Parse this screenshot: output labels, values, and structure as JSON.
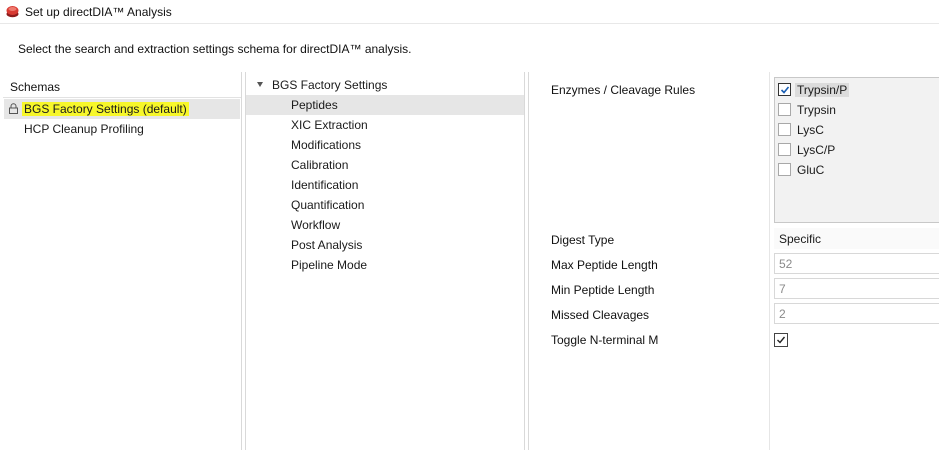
{
  "window": {
    "title": "Set up directDIA™ Analysis"
  },
  "instruction": "Select the search and extraction settings schema for directDIA™ analysis.",
  "schemas": {
    "header": "Schemas",
    "items": [
      {
        "label": "BGS Factory Settings (default)",
        "selected": true,
        "highlighted": true,
        "locked": true
      },
      {
        "label": "HCP Cleanup Profiling",
        "selected": false
      }
    ]
  },
  "tree": {
    "root": "BGS Factory Settings",
    "items": [
      {
        "label": "Peptides",
        "selected": true
      },
      {
        "label": "XIC Extraction"
      },
      {
        "label": "Modifications"
      },
      {
        "label": "Calibration"
      },
      {
        "label": "Identification"
      },
      {
        "label": "Quantification"
      },
      {
        "label": "Workflow"
      },
      {
        "label": "Post Analysis"
      },
      {
        "label": "Pipeline Mode"
      }
    ]
  },
  "settings": {
    "enzymes_label": "Enzymes / Cleavage Rules",
    "enzymes": [
      {
        "label": "Trypsin/P",
        "checked": true
      },
      {
        "label": "Trypsin",
        "checked": false
      },
      {
        "label": "LysC",
        "checked": false
      },
      {
        "label": "LysC/P",
        "checked": false
      },
      {
        "label": "GluC",
        "checked": false
      }
    ],
    "digest_type": {
      "label": "Digest Type",
      "value": "Specific"
    },
    "max_peptide_length": {
      "label": "Max Peptide Length",
      "value": "52"
    },
    "min_peptide_length": {
      "label": "Min Peptide Length",
      "value": "7"
    },
    "missed_cleavages": {
      "label": "Missed Cleavages",
      "value": "2"
    },
    "toggle_n_terminal_m": {
      "label": "Toggle N-terminal M",
      "checked": true
    }
  },
  "colors": {
    "highlight": "#f7f72a",
    "selection": "#e6e6e6",
    "app_icon": "#c62828"
  },
  "icons": {
    "app": "app-icon",
    "lock": "lock-icon",
    "caret": "expand-caret-icon",
    "check": "checkmark-icon"
  }
}
